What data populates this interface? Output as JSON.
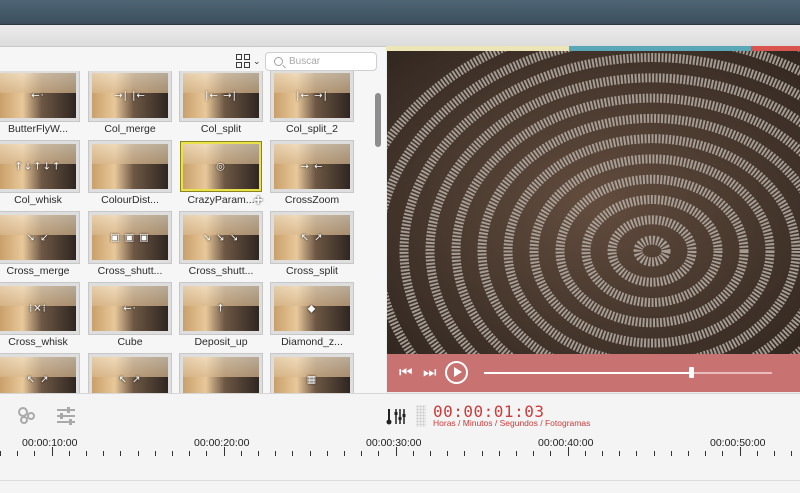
{
  "search": {
    "placeholder": "Buscar"
  },
  "view_toggle": {
    "icon": "grid-view-icon",
    "chevron": "⌄"
  },
  "transitions": [
    {
      "label": "ButterFlyW...",
      "glyph": "←·"
    },
    {
      "label": "Col_merge",
      "glyph": "→| |←"
    },
    {
      "label": "Col_split",
      "glyph": "|← →|"
    },
    {
      "label": "Col_split_2",
      "glyph": "|← →|"
    },
    {
      "label": "Col_whisk",
      "glyph": "↑↓↑↓↑"
    },
    {
      "label": "ColourDist...",
      "glyph": ""
    },
    {
      "label": "CrazyParam...",
      "glyph": "◎",
      "selected": true
    },
    {
      "label": "CrossZoom",
      "glyph": "→ ←"
    },
    {
      "label": "Cross_merge",
      "glyph": "↘ ↙"
    },
    {
      "label": "Cross_shutt...",
      "glyph": "▣ ▣ ▣"
    },
    {
      "label": "Cross_shutt...",
      "glyph": "↘ ↘ ↘"
    },
    {
      "label": "Cross_split",
      "glyph": "↖ ↗"
    },
    {
      "label": "Cross_whisk",
      "glyph": "⁞✕⁞"
    },
    {
      "label": "Cube",
      "glyph": "←·"
    },
    {
      "label": "Deposit_up",
      "glyph": "↑"
    },
    {
      "label": "Diamond_z...",
      "glyph": "◆"
    },
    {
      "label": "",
      "glyph": "↖ ↗"
    },
    {
      "label": "",
      "glyph": "↖ ↗"
    },
    {
      "label": "",
      "glyph": ""
    },
    {
      "label": "",
      "glyph": "▦"
    }
  ],
  "preview": {
    "description_icon": "crazy-parametric-preview"
  },
  "player": {
    "prev_label": "⏮",
    "next_label": "⏭",
    "progress": 0.72,
    "accent": "#c97272"
  },
  "timecode": {
    "value": "00:00:01:03",
    "sub": "Horas / Minutos / Segundos / Fotogramas",
    "color": "#cc3b3b"
  },
  "ruler": {
    "labels": [
      "00:00:10:00",
      "00:00:20:00",
      "00:00:30:00",
      "00:00:40:00",
      "00:00:50:00"
    ]
  },
  "accents": {
    "yellow": "#ece5b8",
    "teal": "#5aa7b8",
    "red": "#d9534f"
  }
}
